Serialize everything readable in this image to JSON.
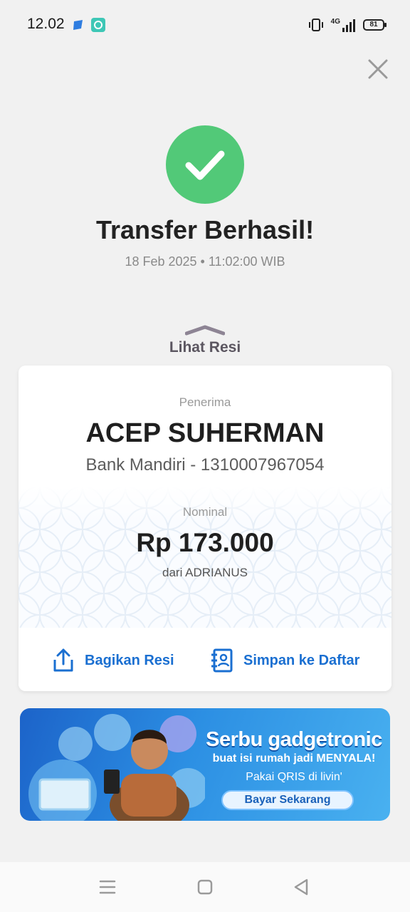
{
  "status_bar": {
    "time": "12.02",
    "network": "4G",
    "battery": "81"
  },
  "success": {
    "title": "Transfer Berhasil!",
    "datetime": "18 Feb 2025 • 11:02:00 WIB"
  },
  "receipt_toggle": {
    "label": "Lihat Resi"
  },
  "receipt": {
    "recipient_label": "Penerima",
    "recipient_name": "ACEP SUHERMAN",
    "recipient_bank": "Bank Mandiri - 1310007967054",
    "nominal_label": "Nominal",
    "amount": "Rp 173.000",
    "sender": "dari ADRIANUS"
  },
  "actions": {
    "share_label": "Bagikan Resi",
    "save_label": "Simpan ke Daftar"
  },
  "banner": {
    "title": "Serbu gadgetronic",
    "subtitle": "buat isi rumah jadi MENYALA!",
    "payment": "Pakai QRIS di livin'",
    "cta": "Bayar Sekarang"
  },
  "colors": {
    "success_green": "#52c978",
    "action_blue": "#1a6fd1",
    "background": "#f1f1f1"
  }
}
